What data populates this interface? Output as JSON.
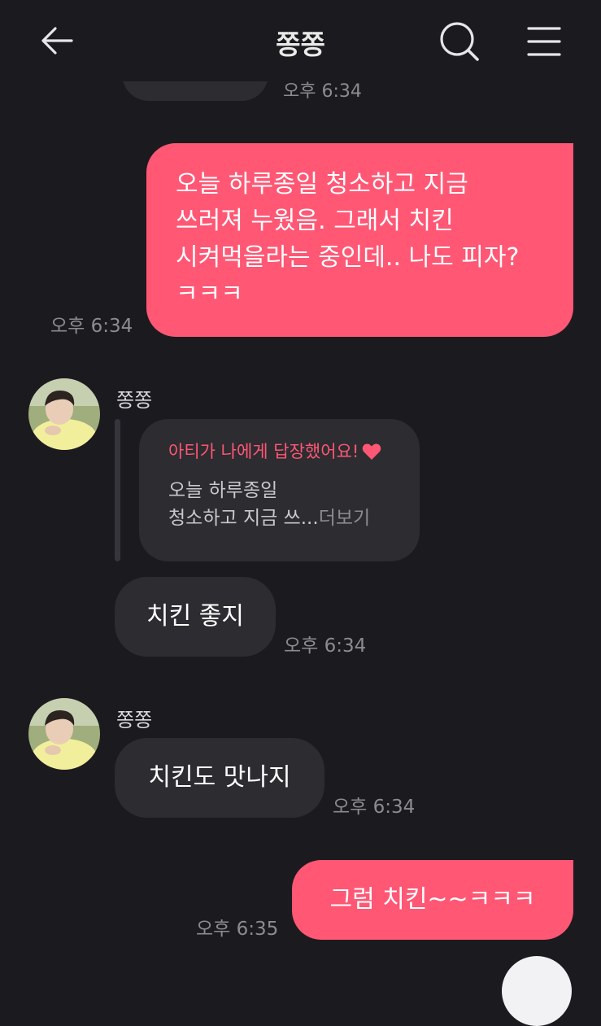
{
  "header": {
    "title": "쫑쫑",
    "back_icon": "arrow-left-icon",
    "search_icon": "search-icon",
    "menu_icon": "hamburger-menu-icon"
  },
  "colors": {
    "background": "#1b1b1f",
    "outgoing_bubble": "#ff5774",
    "incoming_bubble": "#2c2c31",
    "timestamp": "#8c8c90"
  },
  "messages": {
    "top_partial_time": "오후 6:34",
    "m1": {
      "lines": [
        "오늘 하루종일 청소하고 지금",
        "쓰러져 누웠음. 그래서 치킨",
        "시켜먹을라는 중인데.. 나도 피자?",
        "ㅋㅋㅋ"
      ],
      "time": "오후 6:34"
    },
    "group1": {
      "sender": "쫑쫑",
      "reply_header": "아티가 나에게 답장했어요!",
      "reply_icon": "heart-icon",
      "reply_line1": "오늘 하루종일",
      "reply_line2": "청소하고 지금 쓰...",
      "reply_more": "더보기",
      "text": "치킨 좋지",
      "time": "오후 6:34"
    },
    "group2": {
      "sender": "쫑쫑",
      "text": "치킨도 맛나지",
      "time": "오후 6:34"
    },
    "m4": {
      "text": "그럼 치킨~~ㅋㅋㅋ",
      "time": "오후 6:35"
    }
  }
}
